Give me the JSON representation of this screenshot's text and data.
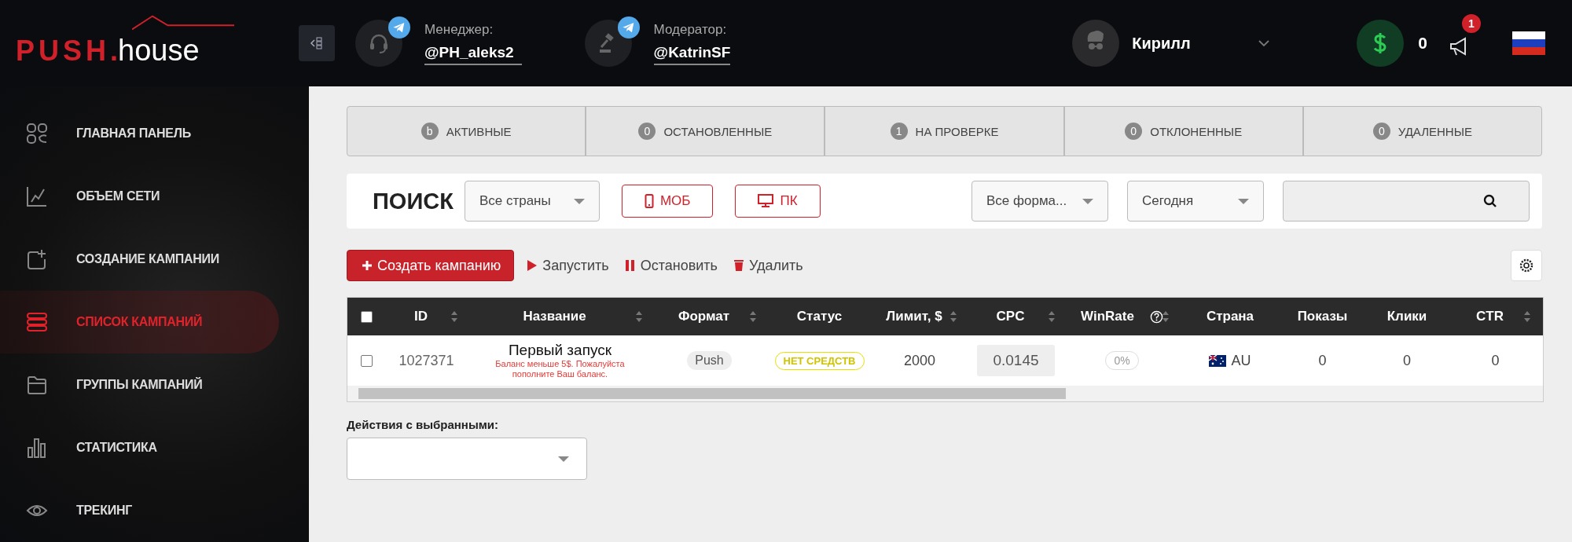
{
  "logo": {
    "brand": "PUSH",
    "separator": ".",
    "suffix": "house"
  },
  "contacts": [
    {
      "kind": "manager",
      "label": "Менеджер:",
      "handle": "@PH_aleks2"
    },
    {
      "kind": "moderator",
      "label": "Модератор:",
      "handle": "@KatrinSF"
    }
  ],
  "user": {
    "name": "Кирилл"
  },
  "balance": "0",
  "notifications": {
    "count": "1"
  },
  "sidebar": {
    "items": [
      {
        "label": "ГЛАВНАЯ ПАНЕЛЬ",
        "selected": false
      },
      {
        "label": "ОБЪЕМ СЕТИ",
        "selected": false
      },
      {
        "label": "СОЗДАНИЕ КАМПАНИИ",
        "selected": false
      },
      {
        "label": "СПИСОК КАМПАНИЙ",
        "selected": true
      },
      {
        "label": "ГРУППЫ КАМПАНИЙ",
        "selected": false
      },
      {
        "label": "СТАТИСТИКА",
        "selected": false
      },
      {
        "label": "ТРЕКИНГ",
        "selected": false
      }
    ]
  },
  "status_tabs": [
    {
      "count": "b",
      "label": "АКТИВНЫЕ",
      "selected": false
    },
    {
      "count": "0",
      "label": "ОСТАНОВЛЕННЫЕ",
      "selected": false
    },
    {
      "count": "1",
      "label": "НА ПРОВЕРКЕ",
      "selected": false
    },
    {
      "count": "0",
      "label": "ОТКЛОНЕННЫЕ",
      "selected": false
    },
    {
      "count": "0",
      "label": "УДАЛЕННЫЕ",
      "selected": false
    }
  ],
  "search": {
    "title": "ПОИСК",
    "country": "Все страны",
    "mobile": {
      "label": "МОБ",
      "selected": false
    },
    "desktop": {
      "label": "ПК",
      "selected": false
    },
    "format": "Все форма...",
    "period": "Сегодня"
  },
  "actions": {
    "create": "Создать кампанию",
    "start": "Запустить",
    "stop": "Остановить",
    "delete": "Удалить"
  },
  "table": {
    "select_all": false,
    "columns": [
      {
        "label": "ID",
        "sortable": true
      },
      {
        "label": "Название",
        "sortable": true
      },
      {
        "label": "Формат",
        "sortable": true
      },
      {
        "label": "Статус"
      },
      {
        "label": "Лимит, $",
        "sortable": true
      },
      {
        "label": "CPC",
        "sortable": true
      },
      {
        "label": "WinRate",
        "sortable": true,
        "help": true
      },
      {
        "label": "Страна"
      },
      {
        "label": "Показы"
      },
      {
        "label": "Клики"
      },
      {
        "label": "CTR",
        "sortable": true
      }
    ],
    "rows": [
      {
        "checked": false,
        "id": "1027371",
        "name": "Первый запуск",
        "warning": "Баланс меньше 5$. Пожалуйста пополните Ваш баланс.",
        "format": "Push",
        "status": "НЕТ СРЕДСТВ",
        "limit": "2000",
        "cpc": "0.0145",
        "winrate": "0%",
        "country": "AU",
        "impressions": "0",
        "clicks": "0",
        "ctr": "0"
      }
    ]
  },
  "bulk": {
    "label": "Действия с выбранными:"
  }
}
